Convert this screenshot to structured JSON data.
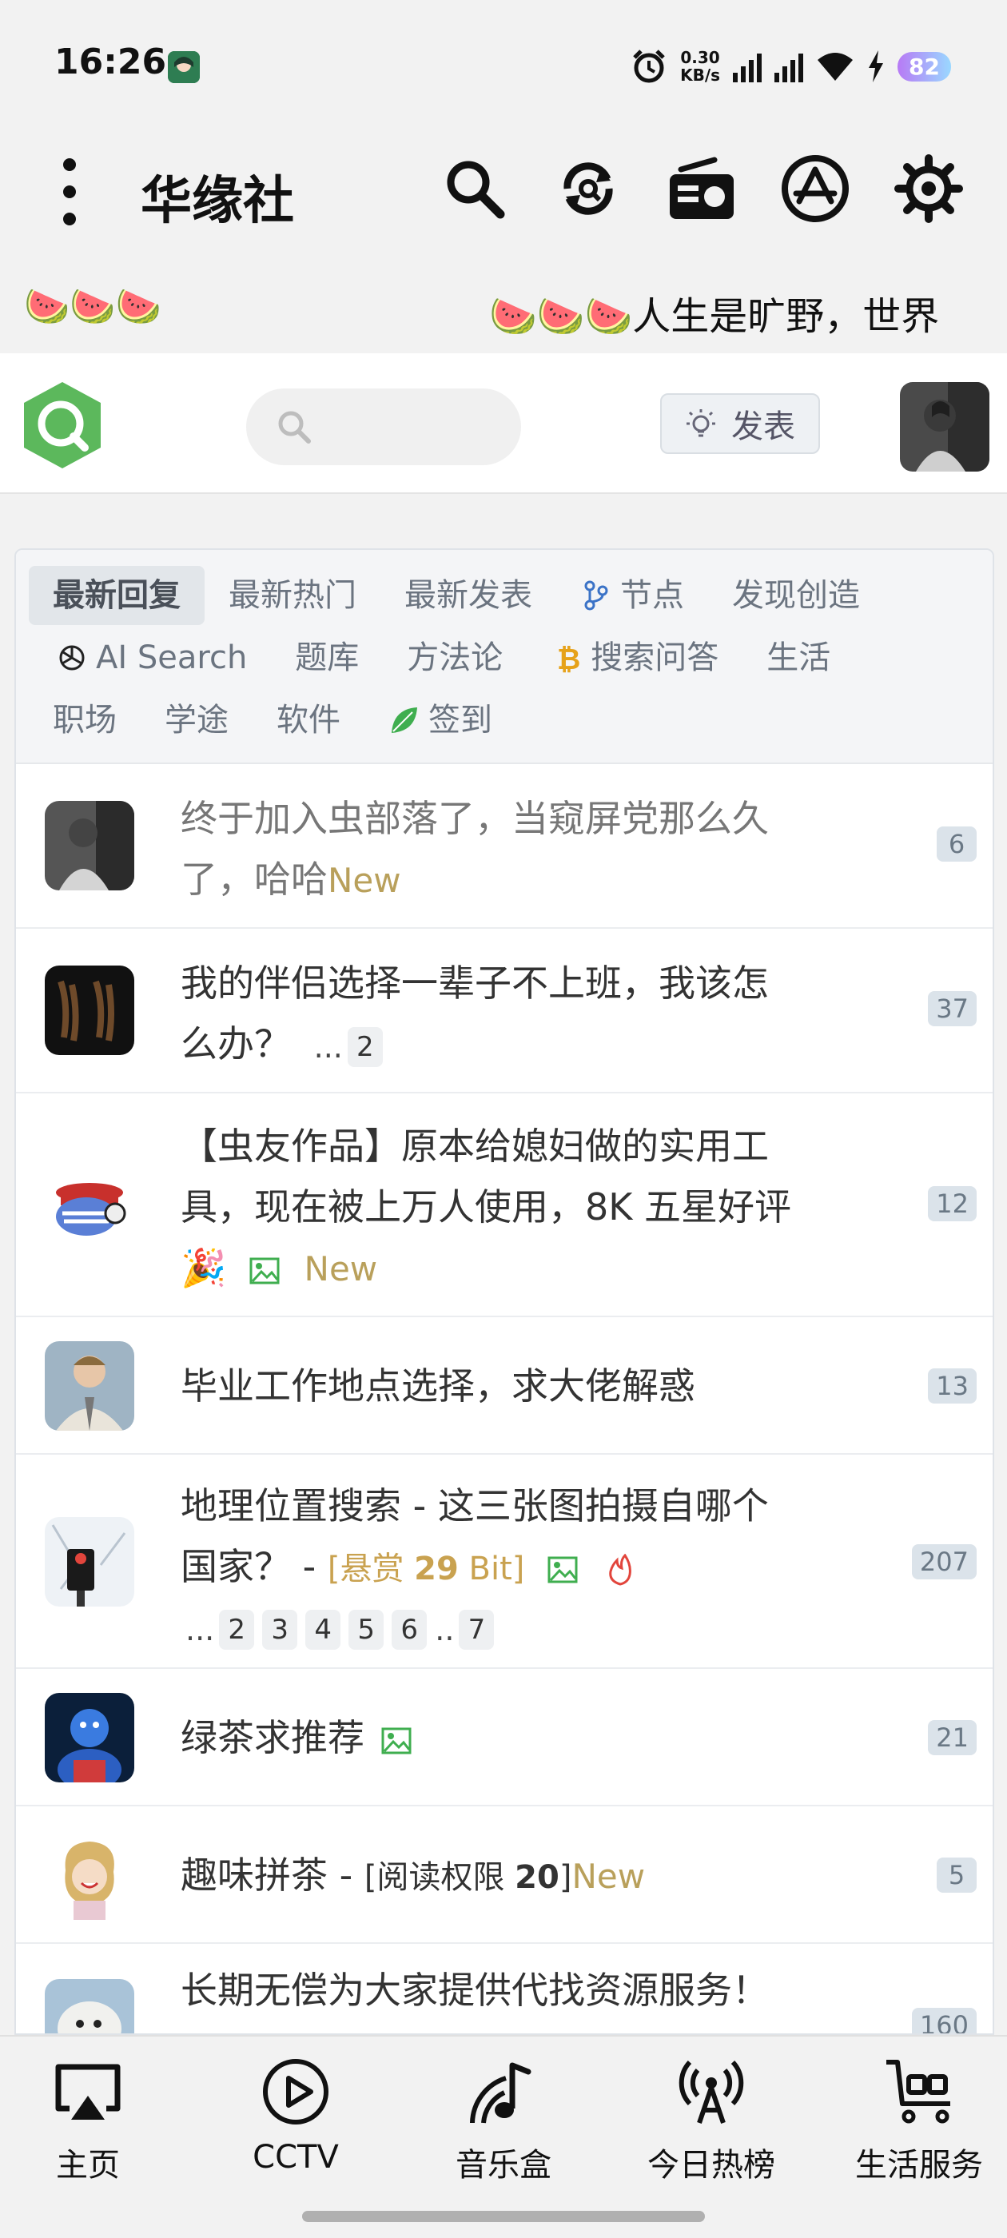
{
  "status_bar": {
    "time": "16:26",
    "net_speed_value": "0.30",
    "net_speed_unit": "KB/s",
    "signal1_label": "5G",
    "signal2_label": "5G",
    "battery": "82"
  },
  "app_header": {
    "title": "华缘社",
    "icons": [
      "search-icon",
      "refresh-icon",
      "radio-icon",
      "app-store-icon",
      "settings-icon"
    ]
  },
  "marquee": {
    "left_text": "🍉🍉🍉",
    "right_text": "🍉🍉🍉人生是旷野，世界"
  },
  "site_bar": {
    "post_button_label": "发表"
  },
  "tabs": {
    "row1": [
      "最新回复",
      "最新热门",
      "最新发表",
      "节点",
      "发现创造"
    ],
    "row2": [
      "AI Search",
      "题库",
      "方法论",
      "搜索问答",
      "生活"
    ],
    "row3": [
      "职场",
      "学途",
      "软件",
      "签到"
    ]
  },
  "topics": [
    {
      "line1": "终于加入虫部落了，当窥屏党那么久",
      "line2": "了，哈哈",
      "new": "New",
      "count": "6"
    },
    {
      "line1": "我的伴侣选择一辈子不上班，我该怎",
      "line2": "么办？",
      "pages": [
        "2"
      ],
      "count": "37"
    },
    {
      "line1": "【虫友作品】原本给媳妇做的实用工",
      "line2": "具，现在被上万人使用，8K 五星好评",
      "line3_emoji": "🎉",
      "new": "New",
      "count": "12"
    },
    {
      "line1": "毕业工作地点选择，求大佬解惑",
      "count": "13"
    },
    {
      "line1": "地理位置搜索 - 这三张图拍摄自哪个",
      "line2": "国家？ - ",
      "bounty_prefix": "[悬赏 ",
      "bounty_value": "29",
      "bounty_suffix": " Bit]",
      "pages": [
        "2",
        "3",
        "4",
        "5",
        "6",
        "7"
      ],
      "count": "207"
    },
    {
      "line1": "绿茶求推荐",
      "count": "21"
    },
    {
      "line1": "趣味拼茶 - ",
      "perm_prefix": "[阅读权限 ",
      "perm_value": "20",
      "perm_suffix": "]",
      "new": "New",
      "count": "5"
    },
    {
      "line1": "长期无偿为大家提供代找资源服务！",
      "count": "160"
    }
  ],
  "bottom_nav": [
    {
      "label": "主页",
      "icon": "airplay-icon"
    },
    {
      "label": "CCTV",
      "icon": "play-icon"
    },
    {
      "label": "音乐盒",
      "icon": "music-icon"
    },
    {
      "label": "今日热榜",
      "icon": "broadcast-icon"
    },
    {
      "label": "生活服务",
      "icon": "cart-icon"
    }
  ],
  "colors": {
    "new_tag": "#b9a05b",
    "bounty": "#c9a250",
    "green_icon": "#3fae4f",
    "fire": "#e2453c",
    "logo_green": "#5cb85c"
  }
}
